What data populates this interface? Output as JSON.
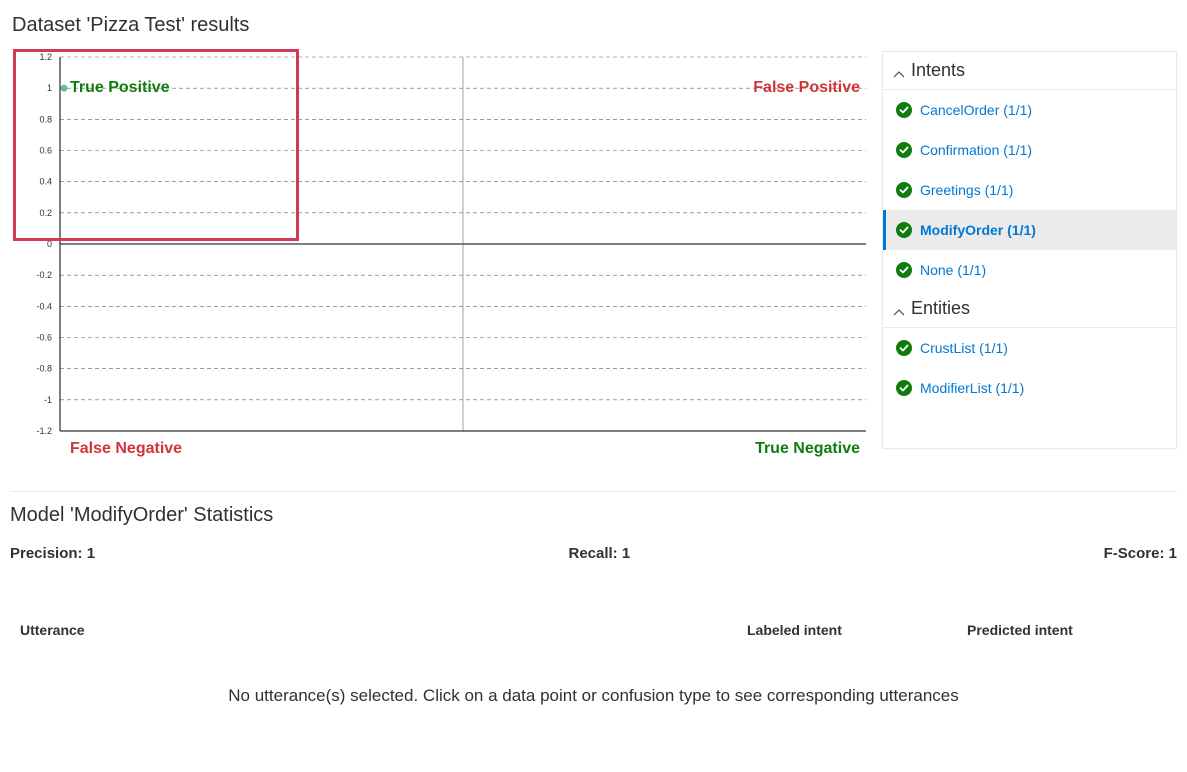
{
  "header": {
    "title": "Dataset 'Pizza Test' results"
  },
  "chart_data": {
    "type": "scatter",
    "title": "",
    "xlabel": "",
    "ylabel": "",
    "xlim": [
      -1,
      1
    ],
    "ylim": [
      -1.2,
      1.2
    ],
    "yticks": [
      1.2,
      1,
      0.8,
      0.6,
      0.4,
      0.2,
      0,
      -0.2,
      -0.4,
      -0.6,
      -0.8,
      -1,
      -1.2
    ],
    "series": [
      {
        "name": "points",
        "x": [
          -0.99
        ],
        "y": [
          1
        ],
        "color": "#6cb9a3"
      }
    ],
    "quadrant_labels": {
      "top_left": "True Positive",
      "top_right": "False Positive",
      "bottom_left": "False Negative",
      "bottom_right": "True Negative"
    },
    "quadrant_colors": {
      "top_left": "#107c10",
      "top_right": "#d13438",
      "bottom_left": "#d13438",
      "bottom_right": "#107c10"
    }
  },
  "sidebar": {
    "intents_label": "Intents",
    "entities_label": "Entities",
    "intents": [
      {
        "label": "CancelOrder (1/1)",
        "status": "ok",
        "selected": false
      },
      {
        "label": "Confirmation (1/1)",
        "status": "ok",
        "selected": false
      },
      {
        "label": "Greetings (1/1)",
        "status": "ok",
        "selected": false
      },
      {
        "label": "ModifyOrder (1/1)",
        "status": "ok",
        "selected": true
      },
      {
        "label": "None (1/1)",
        "status": "ok",
        "selected": false
      }
    ],
    "entities": [
      {
        "label": "CrustList (1/1)",
        "status": "ok"
      },
      {
        "label": "ModifierList (1/1)",
        "status": "ok"
      }
    ]
  },
  "stats": {
    "title": "Model 'ModifyOrder' Statistics",
    "precision_label": "Precision: 1",
    "recall_label": "Recall: 1",
    "fscore_label": "F-Score: 1"
  },
  "table": {
    "col_utterance": "Utterance",
    "col_labeled": "Labeled intent",
    "col_predicted": "Predicted intent",
    "empty_message": "No utterance(s) selected. Click on a data point or confusion type to see corresponding utterances"
  }
}
